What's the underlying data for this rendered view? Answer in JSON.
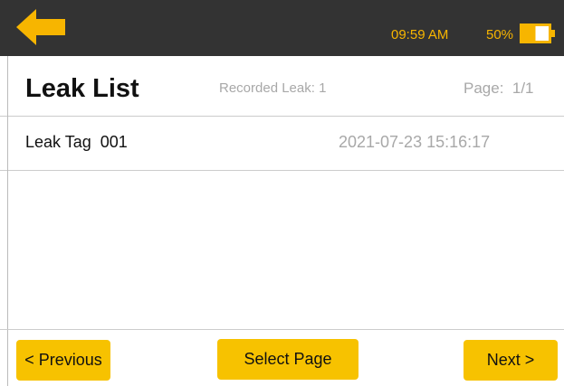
{
  "status_bar": {
    "time": "09:59 AM",
    "battery_percent": "50%",
    "battery_level": 0.5,
    "accent_color": "#f7b500",
    "background_color": "#333333"
  },
  "header": {
    "title": "Leak List",
    "recorded_text": "Recorded Leak: 1",
    "page_text": "Page:  1/1"
  },
  "leaks": [
    {
      "tag": "Leak Tag  001",
      "timestamp": "2021-07-23 15:16:17"
    }
  ],
  "footer": {
    "previous_label": "< Previous",
    "select_page_label": "Select Page",
    "next_label": "Next >",
    "button_color": "#f7c200"
  },
  "icons": {
    "back": "arrow-left-icon",
    "battery": "battery-icon"
  }
}
